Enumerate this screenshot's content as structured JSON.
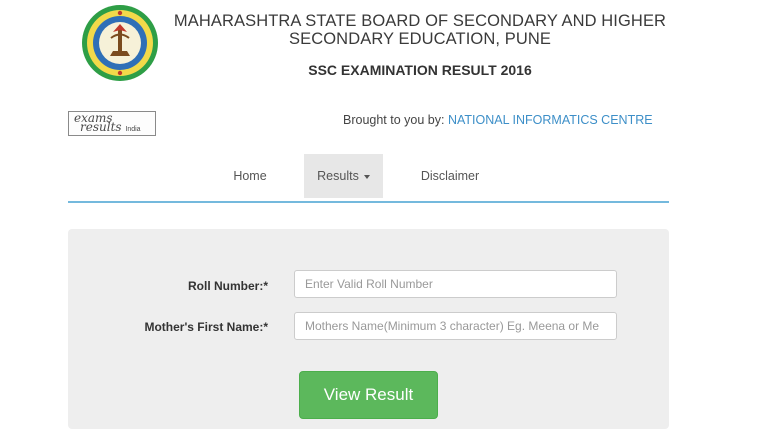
{
  "header": {
    "title_line1": "MAHARASHTRA STATE BOARD OF SECONDARY AND HIGHER",
    "title_line2": "SECONDARY EDUCATION, PUNE",
    "exam_title": "SSC EXAMINATION RESULT 2016",
    "logo_icon": "maharashtra-board-seal-icon"
  },
  "partner": {
    "logo_word1": "exams",
    "logo_word2": "results",
    "logo_word3": "India",
    "brought_prefix": "Brought to you by:",
    "brought_org": "NATIONAL INFORMATICS CENTRE"
  },
  "nav": {
    "home": "Home",
    "results": "Results",
    "disclaimer": "Disclaimer"
  },
  "form": {
    "roll_label": "Roll Number:*",
    "roll_placeholder": "Enter Valid Roll Number",
    "roll_value": "",
    "mother_label": "Mother's First Name:*",
    "mother_placeholder": "Mothers Name(Minimum 3 character) Eg. Meena or Me",
    "mother_value": "",
    "submit_label": "View Result"
  },
  "colors": {
    "accent_line": "#74b9dd",
    "link": "#3d8fc8",
    "button": "#5cb85c",
    "panel": "#eeeeee"
  }
}
